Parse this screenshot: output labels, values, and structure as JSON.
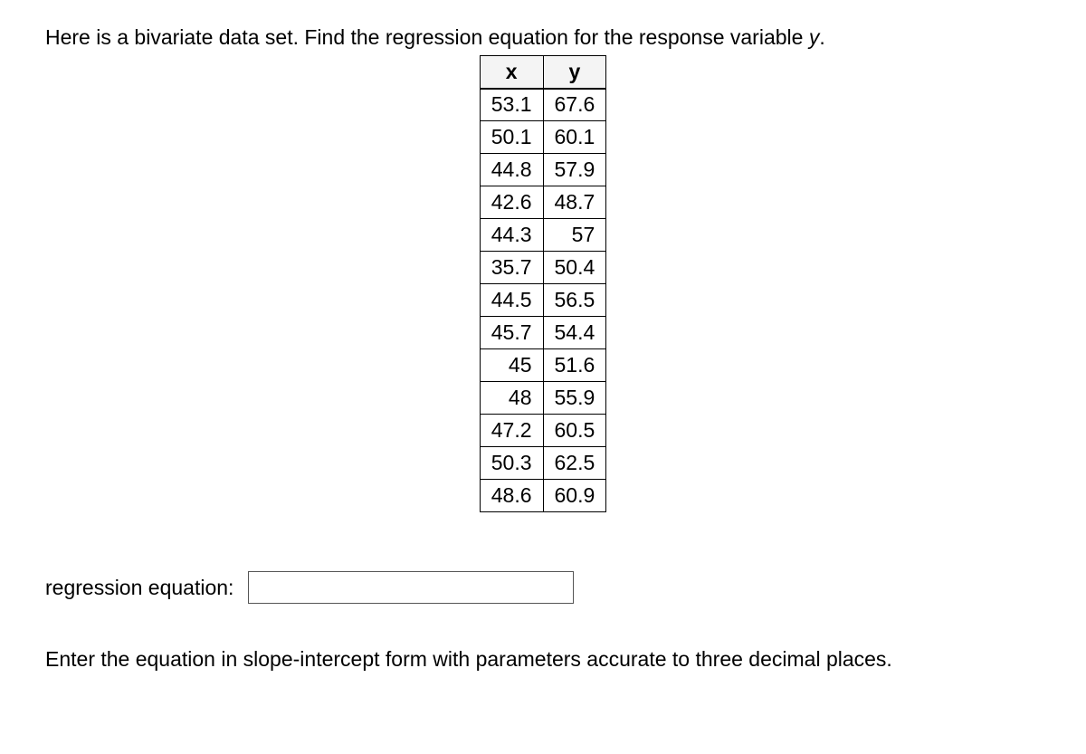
{
  "prompt_text_before_y": "Here is a bivariate data set. Find the regression equation for the response variable ",
  "prompt_y": "y",
  "prompt_text_after_y": ".",
  "table": {
    "headers": {
      "x": "x",
      "y": "y"
    },
    "rows": [
      {
        "x": "53.1",
        "y": "67.6"
      },
      {
        "x": "50.1",
        "y": "60.1"
      },
      {
        "x": "44.8",
        "y": "57.9"
      },
      {
        "x": "42.6",
        "y": "48.7"
      },
      {
        "x": "44.3",
        "y": "57"
      },
      {
        "x": "35.7",
        "y": "50.4"
      },
      {
        "x": "44.5",
        "y": "56.5"
      },
      {
        "x": "45.7",
        "y": "54.4"
      },
      {
        "x": "45",
        "y": "51.6"
      },
      {
        "x": "48",
        "y": "55.9"
      },
      {
        "x": "47.2",
        "y": "60.5"
      },
      {
        "x": "50.3",
        "y": "62.5"
      },
      {
        "x": "48.6",
        "y": "60.9"
      }
    ]
  },
  "answer_label": "regression equation:",
  "answer_value": "",
  "instructions": "Enter the equation in slope-intercept form with parameters accurate to three decimal places.",
  "chart_data": {
    "type": "table",
    "title": "Bivariate data for linear regression",
    "xlabel": "x",
    "ylabel": "y",
    "series": [
      {
        "name": "x",
        "values": [
          53.1,
          50.1,
          44.8,
          42.6,
          44.3,
          35.7,
          44.5,
          45.7,
          45,
          48,
          47.2,
          50.3,
          48.6
        ]
      },
      {
        "name": "y",
        "values": [
          67.6,
          60.1,
          57.9,
          48.7,
          57,
          50.4,
          56.5,
          54.4,
          51.6,
          55.9,
          60.5,
          62.5,
          60.9
        ]
      }
    ]
  }
}
